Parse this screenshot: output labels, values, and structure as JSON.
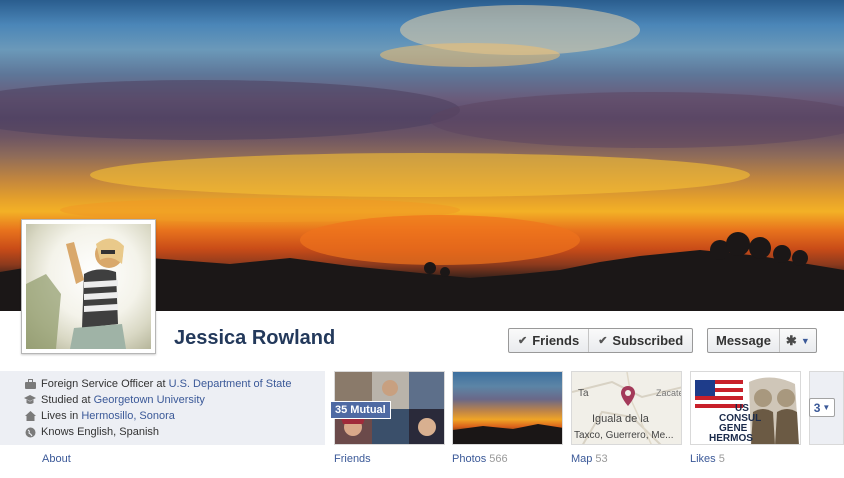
{
  "profile": {
    "name": "Jessica Rowland"
  },
  "actions": {
    "friends_label": "Friends",
    "subscribed_label": "Subscribed",
    "message_label": "Message"
  },
  "info": {
    "work_prefix": "Foreign Service Officer at ",
    "work_link": "U.S. Department of State",
    "study_prefix": "Studied at ",
    "study_link": "Georgetown University",
    "lives_prefix": "Lives in ",
    "lives_link": "Hermosillo, Sonora",
    "languages": "Knows English, Spanish"
  },
  "tiles": {
    "about": {
      "label": "About"
    },
    "friends": {
      "label": "Friends",
      "mutual": "35 Mutual"
    },
    "photos": {
      "label": "Photos",
      "count": "566"
    },
    "map": {
      "label": "Map",
      "count": "53",
      "map_text_1": "Iguala de la",
      "map_text_2": "Taxco, Guerrero, Me...",
      "map_text_3": "Zacate",
      "map_text_4": "Ta"
    },
    "likes": {
      "label": "Likes",
      "count": "5",
      "logo_text_1": "US",
      "logo_text_2": "CONSUL",
      "logo_text_3": "GENE",
      "logo_text_4": "HERMOS"
    },
    "more": {
      "label": "3"
    }
  },
  "colors": {
    "brand": "#3b5998",
    "name": "#23395b",
    "panel": "#edeff4"
  },
  "icons": {
    "work": "briefcase-icon",
    "study": "graduation-cap-icon",
    "home": "house-icon",
    "language": "globe-icon",
    "gear": "gear-icon"
  }
}
